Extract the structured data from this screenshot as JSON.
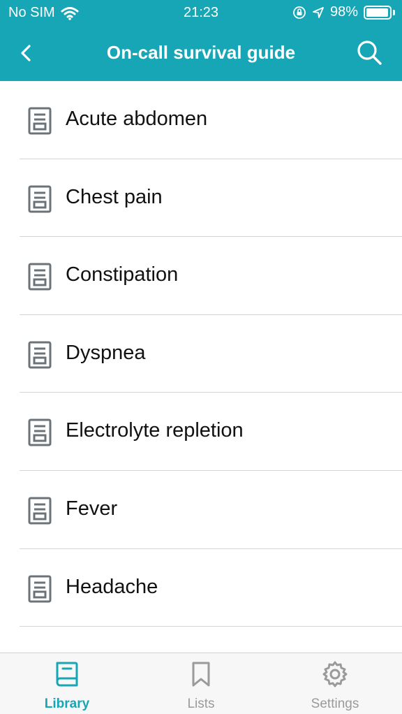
{
  "status_bar": {
    "carrier": "No SIM",
    "time": "21:23",
    "battery": "98%",
    "battery_level": 0.98,
    "icons": [
      "wifi-icon",
      "orientation-lock-icon",
      "location-arrow-icon",
      "battery-icon"
    ]
  },
  "nav": {
    "title": "On-call survival guide",
    "back_icon": "chevron-left-icon",
    "search_icon": "search-icon"
  },
  "list": {
    "item_icon": "document-icon",
    "items": [
      {
        "label": "Acute abdomen"
      },
      {
        "label": "Chest pain"
      },
      {
        "label": "Constipation"
      },
      {
        "label": "Dyspnea"
      },
      {
        "label": "Electrolyte repletion"
      },
      {
        "label": "Fever"
      },
      {
        "label": "Headache"
      }
    ]
  },
  "tabs": [
    {
      "label": "Library",
      "icon": "book-icon",
      "active": true
    },
    {
      "label": "Lists",
      "icon": "bookmark-icon",
      "active": false
    },
    {
      "label": "Settings",
      "icon": "gear-icon",
      "active": false
    }
  ],
  "colors": {
    "accent": "#17a6b6",
    "separator": "#d4d4d4",
    "icon_gray": "#6b7378",
    "tab_inactive": "#9a9a9a"
  }
}
